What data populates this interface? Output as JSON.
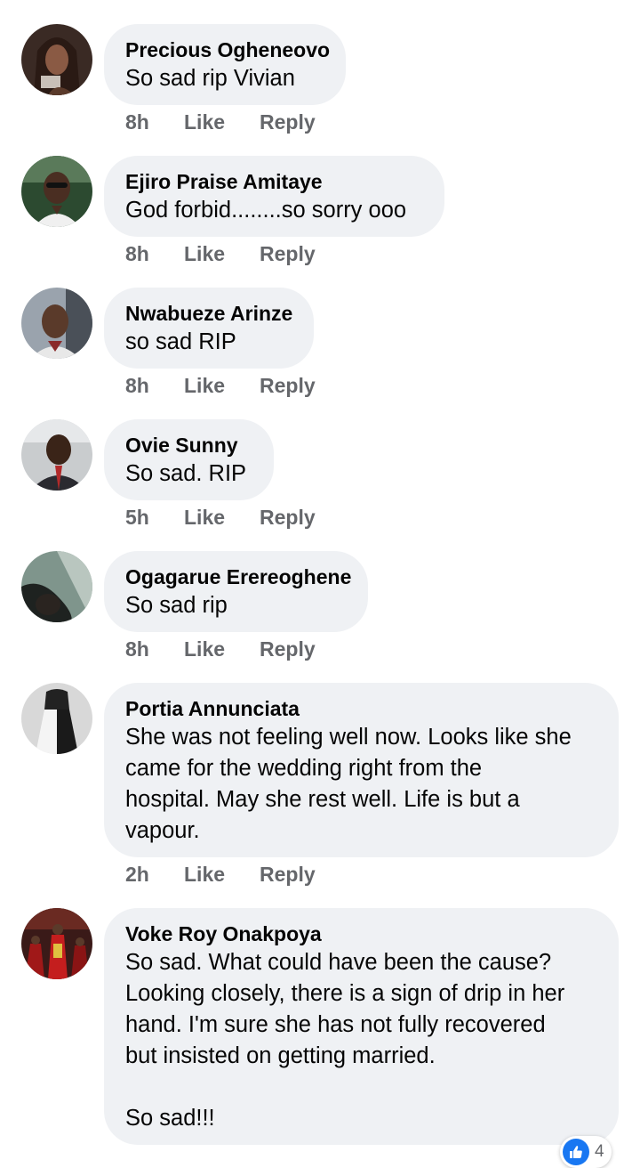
{
  "comments": [
    {
      "author": "Precious Ogheneovo",
      "lines": [
        "So sad rip  Vivian"
      ],
      "time": "8h",
      "like": "Like",
      "reply": "Reply"
    },
    {
      "author": "Ejiro Praise Amitaye",
      "lines": [
        "God forbid........so sorry ooo"
      ],
      "time": "8h",
      "like": "Like",
      "reply": "Reply"
    },
    {
      "author": "Nwabueze Arinze",
      "lines": [
        "so sad RIP"
      ],
      "time": "8h",
      "like": "Like",
      "reply": "Reply"
    },
    {
      "author": "Ovie Sunny",
      "lines": [
        "So sad. RIP"
      ],
      "time": "5h",
      "like": "Like",
      "reply": "Reply"
    },
    {
      "author": "Ogagarue Erereoghene",
      "lines": [
        "So sad rip"
      ],
      "time": "8h",
      "like": "Like",
      "reply": "Reply"
    },
    {
      "author": "Portia Annunciata",
      "lines": [
        "She was not feeling well now. Looks like she",
        "came for the wedding right from the",
        "hospital. May she rest well. Life is but a",
        "vapour."
      ],
      "time": "2h",
      "like": "Like",
      "reply": "Reply"
    },
    {
      "author": "Voke Roy Onakpoya",
      "lines": [
        "So sad. What could have been the cause?",
        "Looking closely, there is a sign of drip in her",
        "hand. I'm sure she has not fully recovered",
        "but insisted on getting married.",
        "",
        "So sad!!!"
      ],
      "reaction_count": "4"
    }
  ],
  "colors": {
    "bubble": "#eff1f4",
    "meta_text": "#65676b",
    "like_blue": "#1877f2"
  },
  "icons": [
    "like-thumb-icon"
  ]
}
